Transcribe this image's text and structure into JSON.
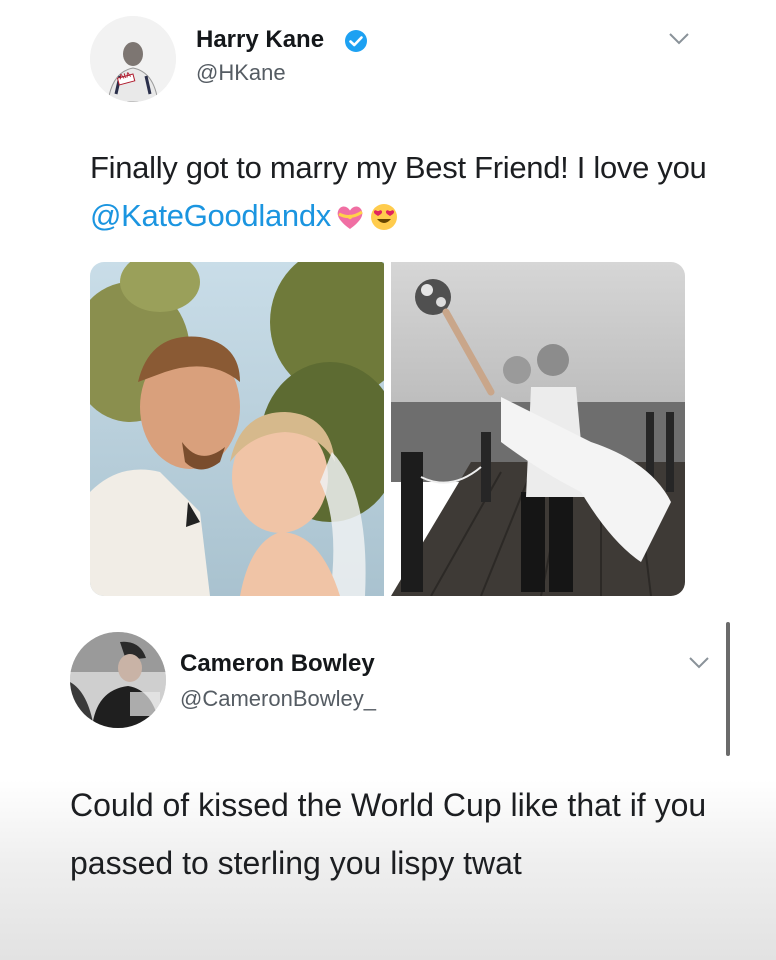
{
  "tweet": {
    "author": {
      "name": "Harry Kane",
      "handle": "@HKane",
      "verified": true,
      "avatar_badge_text": "AIA"
    },
    "text_before": "Finally got to marry my Best Friend! I love you ",
    "mention": "@KateGoodlandx",
    "emojis": [
      "heart-with-ribbon",
      "heart-eyes"
    ],
    "photos": [
      "wedding-kiss-forehead-photo",
      "wedding-pier-carry-photo"
    ]
  },
  "reply": {
    "author": {
      "name": "Cameron Bowley",
      "handle": "@CameronBowley_"
    },
    "text": "Could of kissed the World Cup like that if you passed to sterling you lispy twat"
  },
  "colors": {
    "mention": "#1b95e0",
    "verified": "#1da1f2",
    "handle": "#555c63"
  }
}
